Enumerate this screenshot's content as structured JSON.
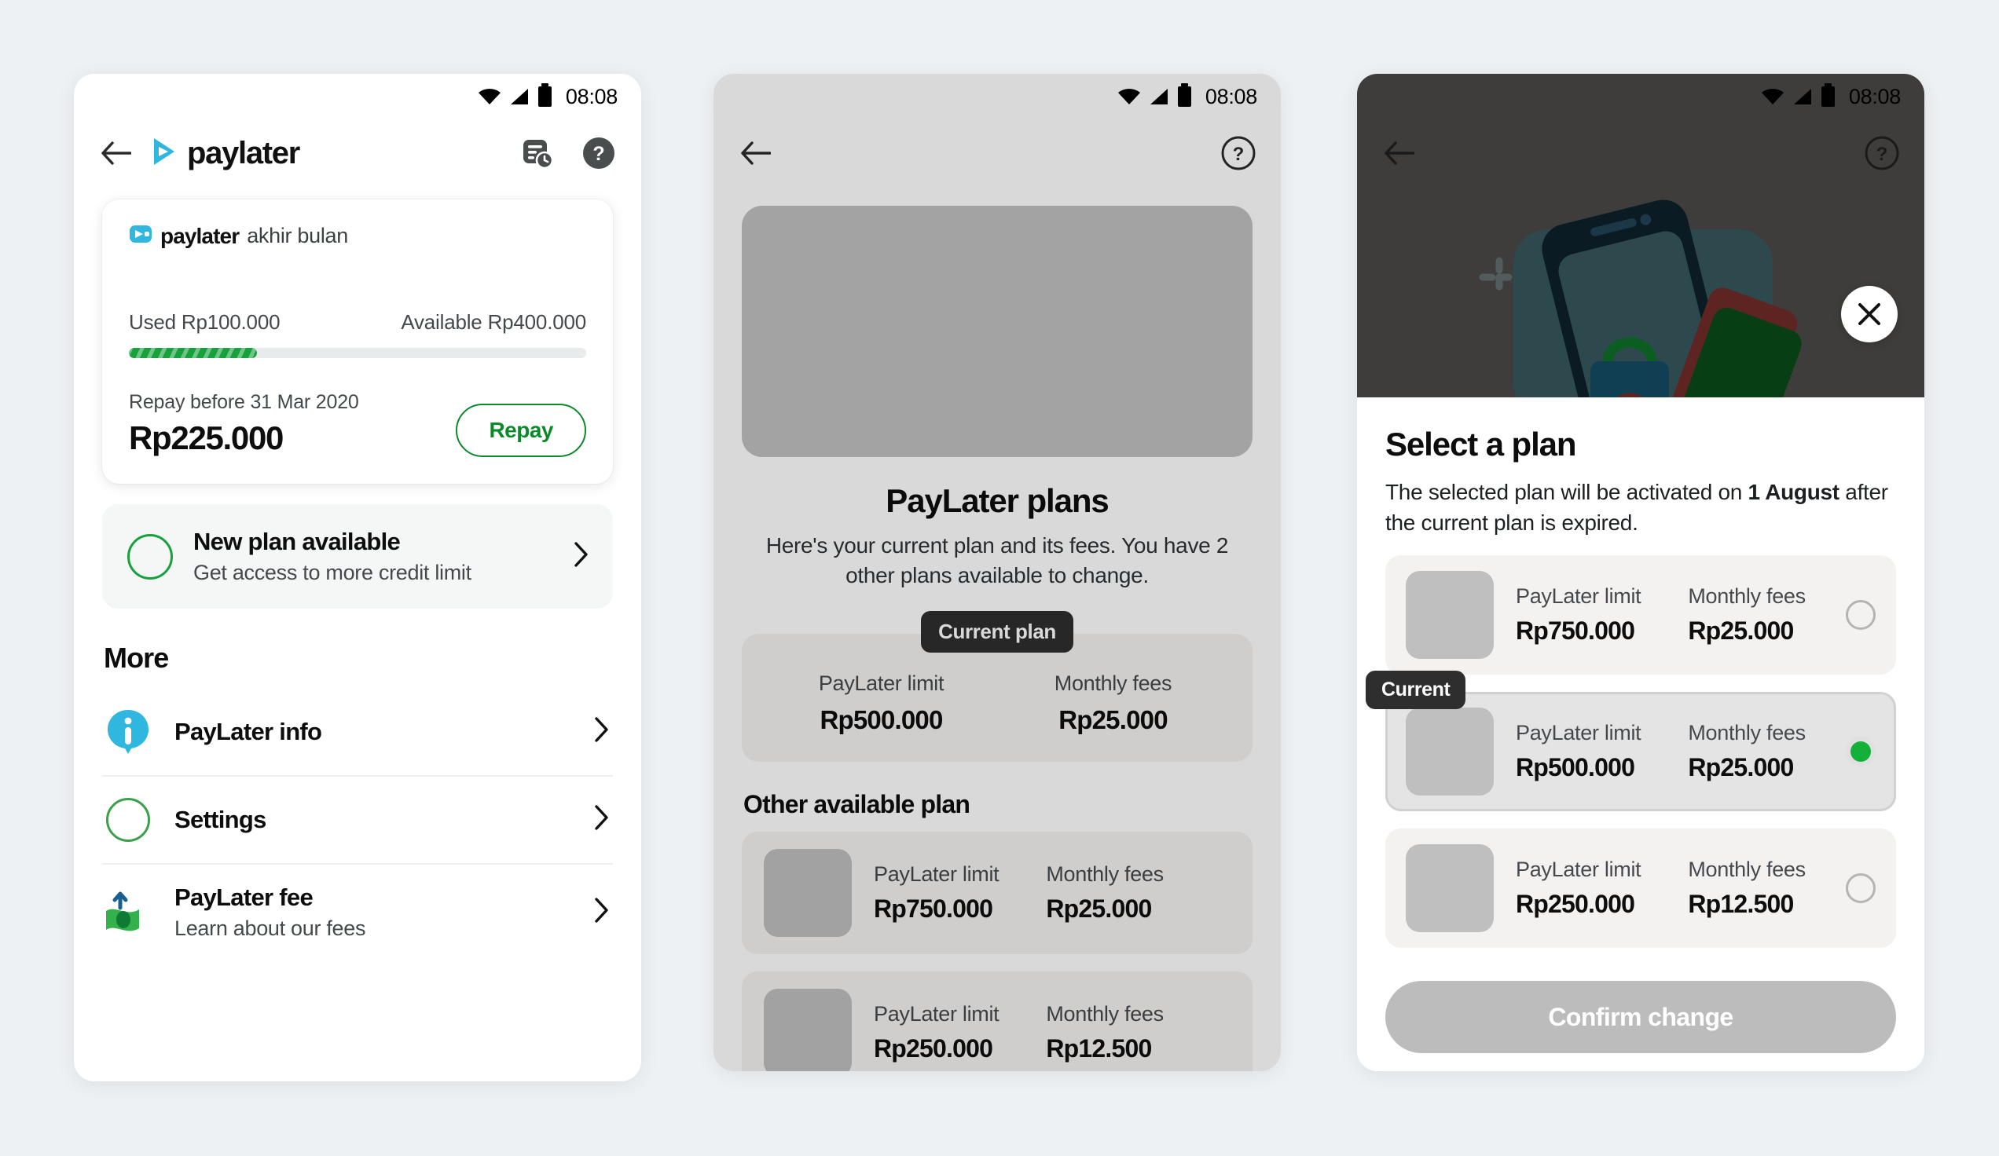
{
  "status_bar": {
    "time": "08:08",
    "icons": [
      "wifi-icon",
      "signal-icon",
      "battery-icon"
    ]
  },
  "colors": {
    "page_bg": "#eef1f4",
    "brand_cyan": "#2fb7e0",
    "brand_green": "#0a8a2a",
    "progress_green": "#17a13d",
    "radio_green": "#14b13a",
    "badge_dark": "#2e2e2e",
    "card_beige": "#f4f2f0",
    "disabled_grey": "#bcbcbc"
  },
  "panel1": {
    "appbar": {
      "back_icon": "back-arrow-icon",
      "brand_word": "paylater",
      "brand_logo_icon": "paylater-chevron-logo-icon",
      "history_icon": "transaction-history-icon",
      "help_icon": "help-question-icon"
    },
    "balance_card": {
      "logo_icon": "paylater-badge-icon",
      "brand": "paylater",
      "plan_name": "akhir bulan",
      "used_label": "Used Rp100.000",
      "available_label": "Available Rp400.000",
      "progress_percent": 28,
      "due_label": "Repay before 31 Mar 2020",
      "amount": "Rp225.000",
      "repay_button": "Repay"
    },
    "new_plan": {
      "icon": "green-circle-icon",
      "title": "New plan available",
      "subtitle": "Get access to more credit limit",
      "chevron": "chevron-right-icon"
    },
    "more_heading": "More",
    "more_items": [
      {
        "icon": "paylater-info-icon",
        "title": "PayLater info",
        "subtitle": "",
        "chevron": "chevron-right-icon"
      },
      {
        "icon": "settings-circle-icon",
        "title": "Settings",
        "subtitle": "",
        "chevron": "chevron-right-icon"
      },
      {
        "icon": "paylater-fee-money-icon",
        "title": "PayLater fee",
        "subtitle": "Learn about our fees",
        "chevron": "chevron-right-icon"
      }
    ]
  },
  "panel2": {
    "appbar": {
      "back_icon": "back-arrow-icon",
      "help_icon": "help-question-circle-icon"
    },
    "hero_image": "plans-hero-placeholder",
    "title": "PayLater plans",
    "subtitle": "Here's your current plan and its fees. You have 2 other plans available to change.",
    "current_badge": "Current plan",
    "current_plan": {
      "limit_label": "PayLater limit",
      "limit_value": "Rp500.000",
      "fee_label": "Monthly fees",
      "fee_value": "Rp25.000"
    },
    "other_heading": "Other available plan",
    "other_plans": [
      {
        "thumb": "plan-thumbnail",
        "limit_label": "PayLater limit",
        "limit_value": "Rp750.000",
        "fee_label": "Monthly fees",
        "fee_value": "Rp25.000"
      },
      {
        "thumb": "plan-thumbnail",
        "limit_label": "PayLater limit",
        "limit_value": "Rp250.000",
        "fee_label": "Monthly fees",
        "fee_value": "Rp12.500"
      }
    ]
  },
  "panel3": {
    "appbar": {
      "back_icon": "back-arrow-icon",
      "help_icon": "help-question-circle-icon"
    },
    "close_icon": "close-x-icon",
    "sheet_title": "Select a plan",
    "sheet_desc_before": "The selected plan will be activated on ",
    "sheet_desc_bold": "1 August",
    "sheet_desc_after": " after the current plan is expired.",
    "current_tag": "Current",
    "plans": [
      {
        "thumb": "plan-thumbnail",
        "limit_label": "PayLater limit",
        "limit_value": "Rp750.000",
        "fee_label": "Monthly fees",
        "fee_value": "Rp25.000",
        "selected": false
      },
      {
        "thumb": "plan-thumbnail",
        "limit_label": "PayLater limit",
        "limit_value": "Rp500.000",
        "fee_label": "Monthly fees",
        "fee_value": "Rp25.000",
        "selected": true
      },
      {
        "thumb": "plan-thumbnail",
        "limit_label": "PayLater limit",
        "limit_value": "Rp250.000",
        "fee_label": "Monthly fees",
        "fee_value": "Rp12.500",
        "selected": false
      }
    ],
    "confirm_button": "Confirm change"
  }
}
